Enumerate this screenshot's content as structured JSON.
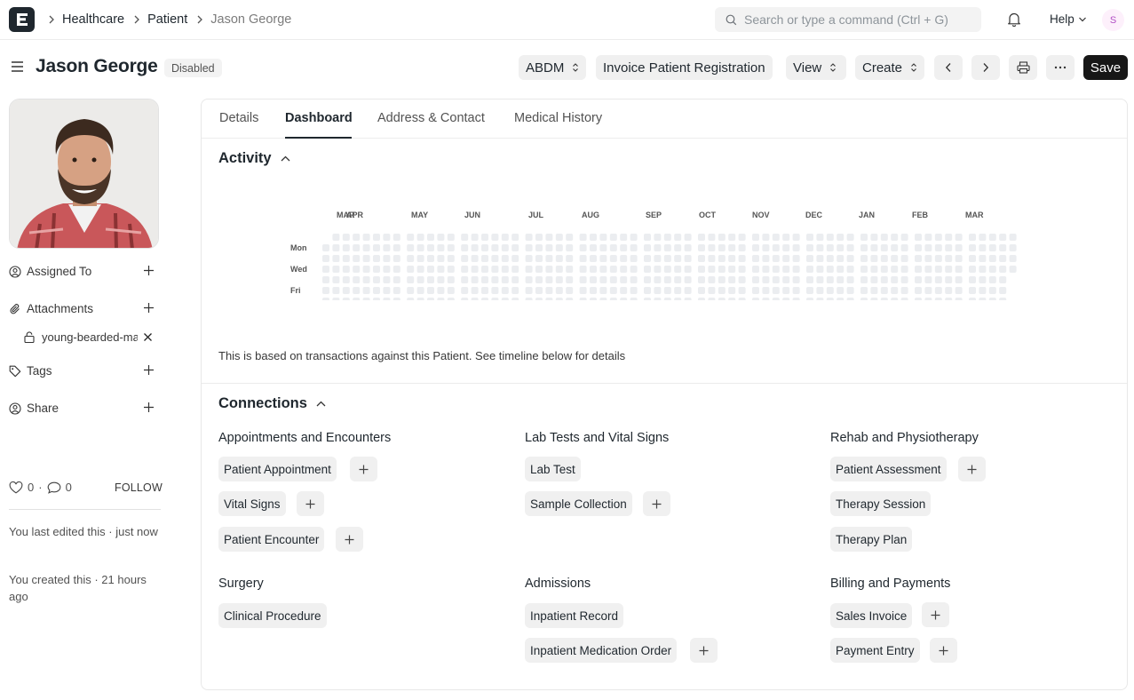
{
  "nav": {
    "logo_letter": "E",
    "breadcrumbs": [
      "Healthcare",
      "Patient",
      "Jason George"
    ],
    "search_placeholder": "Search or type a command (Ctrl + G)",
    "help_label": "Help",
    "user_initial": "S"
  },
  "page": {
    "title": "Jason George",
    "status": "Disabled",
    "buttons": {
      "abdm": "ABDM",
      "invoice": "Invoice Patient Registration",
      "view": "View",
      "create": "Create",
      "save": "Save"
    }
  },
  "sidebar": {
    "assigned_to": "Assigned To",
    "attachments": "Attachments",
    "attachment_file": "young-bearded-man-with-striped-shirt.jpg",
    "tags": "Tags",
    "share": "Share",
    "likes": "0",
    "comments": "0",
    "follow": "FOLLOW",
    "last_edited": "You last edited this · just now",
    "created": "You created this · 21 hours ago"
  },
  "tabs": [
    "Details",
    "Dashboard",
    "Address & Contact",
    "Medical History"
  ],
  "activity": {
    "title": "Activity",
    "months": [
      "MAR",
      "APR",
      "MAY",
      "JUN",
      "JUL",
      "AUG",
      "SEP",
      "OCT",
      "NOV",
      "DEC",
      "JAN",
      "FEB",
      "MAR"
    ],
    "day_labels": [
      "Mon",
      "Wed",
      "Fri"
    ],
    "note": "This is based on transactions against this Patient. See timeline below for details"
  },
  "connections": {
    "title": "Connections",
    "groups": [
      {
        "title": "Appointments and Encounters",
        "items": [
          "Patient Appointment",
          "Vital Signs",
          "Patient Encounter"
        ]
      },
      {
        "title": "Lab Tests and Vital Signs",
        "items": [
          "Lab Test",
          "Sample Collection"
        ]
      },
      {
        "title": "Rehab and Physiotherapy",
        "items": [
          "Patient Assessment",
          "Therapy Session",
          "Therapy Plan"
        ]
      },
      {
        "title": "Surgery",
        "items": [
          "Clinical Procedure"
        ]
      },
      {
        "title": "Admissions",
        "items": [
          "Inpatient Record",
          "Inpatient Medication Order"
        ]
      },
      {
        "title": "Billing and Payments",
        "items": [
          "Sales Invoice",
          "Payment Entry"
        ]
      }
    ]
  },
  "colors": {
    "primary_button": "#171717",
    "heat_empty": "#ebedf0",
    "avatar_bg": "#fdf0fb",
    "avatar_text": "#b24ec4"
  }
}
